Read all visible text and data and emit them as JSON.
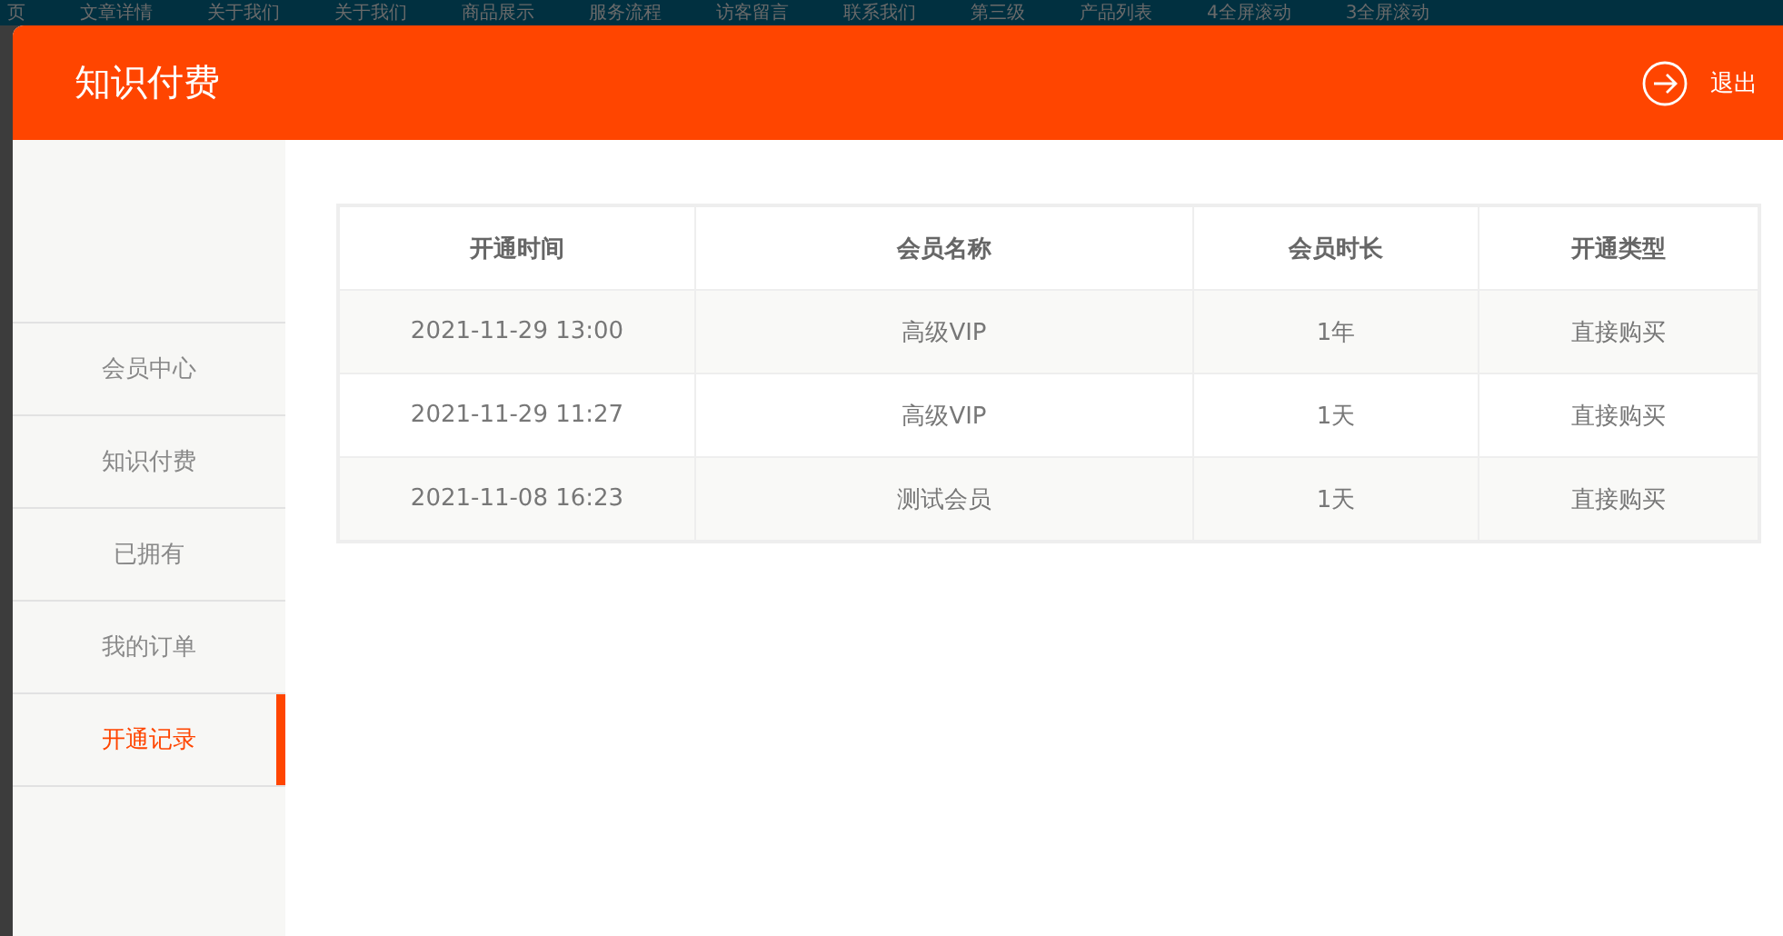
{
  "background_nav": [
    "页",
    "文章详情",
    "关于我们",
    "关于我们",
    "商品展示",
    "服务流程",
    "访客留言",
    "联系我们",
    "第三级",
    "产品列表",
    "4全屏滚动",
    "3全屏滚动"
  ],
  "header": {
    "title": "知识付费",
    "logout": "退出"
  },
  "sidebar": {
    "items": [
      {
        "label": "会员中心",
        "selected": false
      },
      {
        "label": "知识付费",
        "selected": false
      },
      {
        "label": "已拥有",
        "selected": false
      },
      {
        "label": "我的订单",
        "selected": false
      },
      {
        "label": "开通记录",
        "selected": true
      }
    ]
  },
  "table": {
    "columns": [
      "开通时间",
      "会员名称",
      "会员时长",
      "开通类型"
    ],
    "rows": [
      [
        "2021-11-29 13:00",
        "高级VIP",
        "1年",
        "直接购买"
      ],
      [
        "2021-11-29 11:27",
        "高级VIP",
        "1天",
        "直接购买"
      ],
      [
        "2021-11-08 16:23",
        "测试会员",
        "1天",
        "直接购买"
      ]
    ]
  }
}
